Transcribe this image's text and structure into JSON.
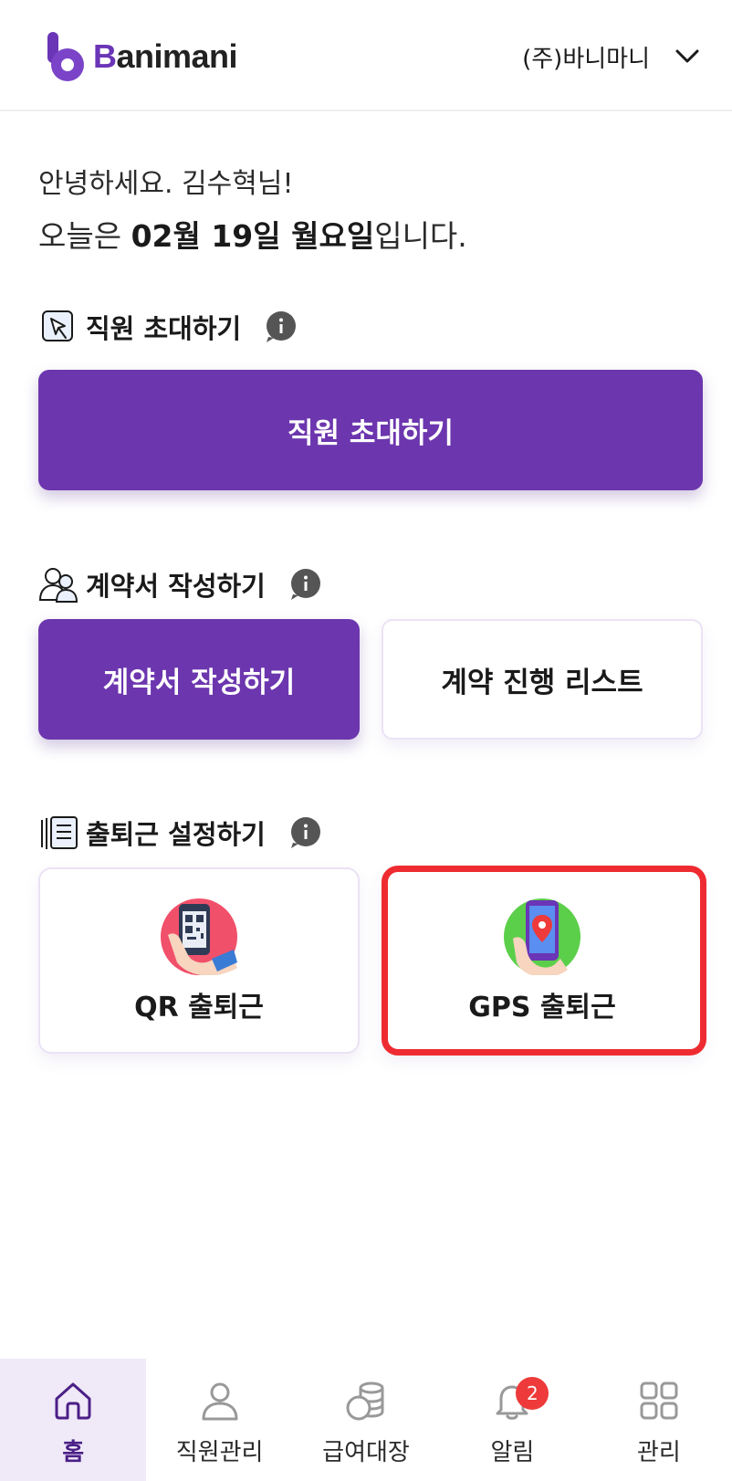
{
  "header": {
    "logo_text_b": "B",
    "logo_text_rest": "animani",
    "company": "(주)바니마니"
  },
  "greeting": {
    "line1": "안녕하세요. 김수혁님!",
    "line2_prefix": "오늘은 ",
    "line2_date": "02월 19일 월요일",
    "line2_suffix": "입니다."
  },
  "invite": {
    "title": "직원 초대하기",
    "button": "직원 초대하기"
  },
  "contract": {
    "title": "계약서 작성하기",
    "button_write": "계약서 작성하기",
    "button_list": "계약 진행 리스트"
  },
  "attendance": {
    "title": "출퇴근 설정하기",
    "qr_label": "QR 출퇴근",
    "gps_label": "GPS 출퇴근"
  },
  "nav": {
    "items": [
      {
        "label": "홈",
        "icon": "home-icon"
      },
      {
        "label": "직원관리",
        "icon": "person-icon"
      },
      {
        "label": "급여대장",
        "icon": "coins-icon"
      },
      {
        "label": "알림",
        "icon": "bell-icon",
        "badge": "2"
      },
      {
        "label": "관리",
        "icon": "grid-icon"
      }
    ]
  },
  "colors": {
    "accent": "#6c36ae",
    "highlight": "#ee2b31",
    "badge": "#ee3a3a"
  }
}
